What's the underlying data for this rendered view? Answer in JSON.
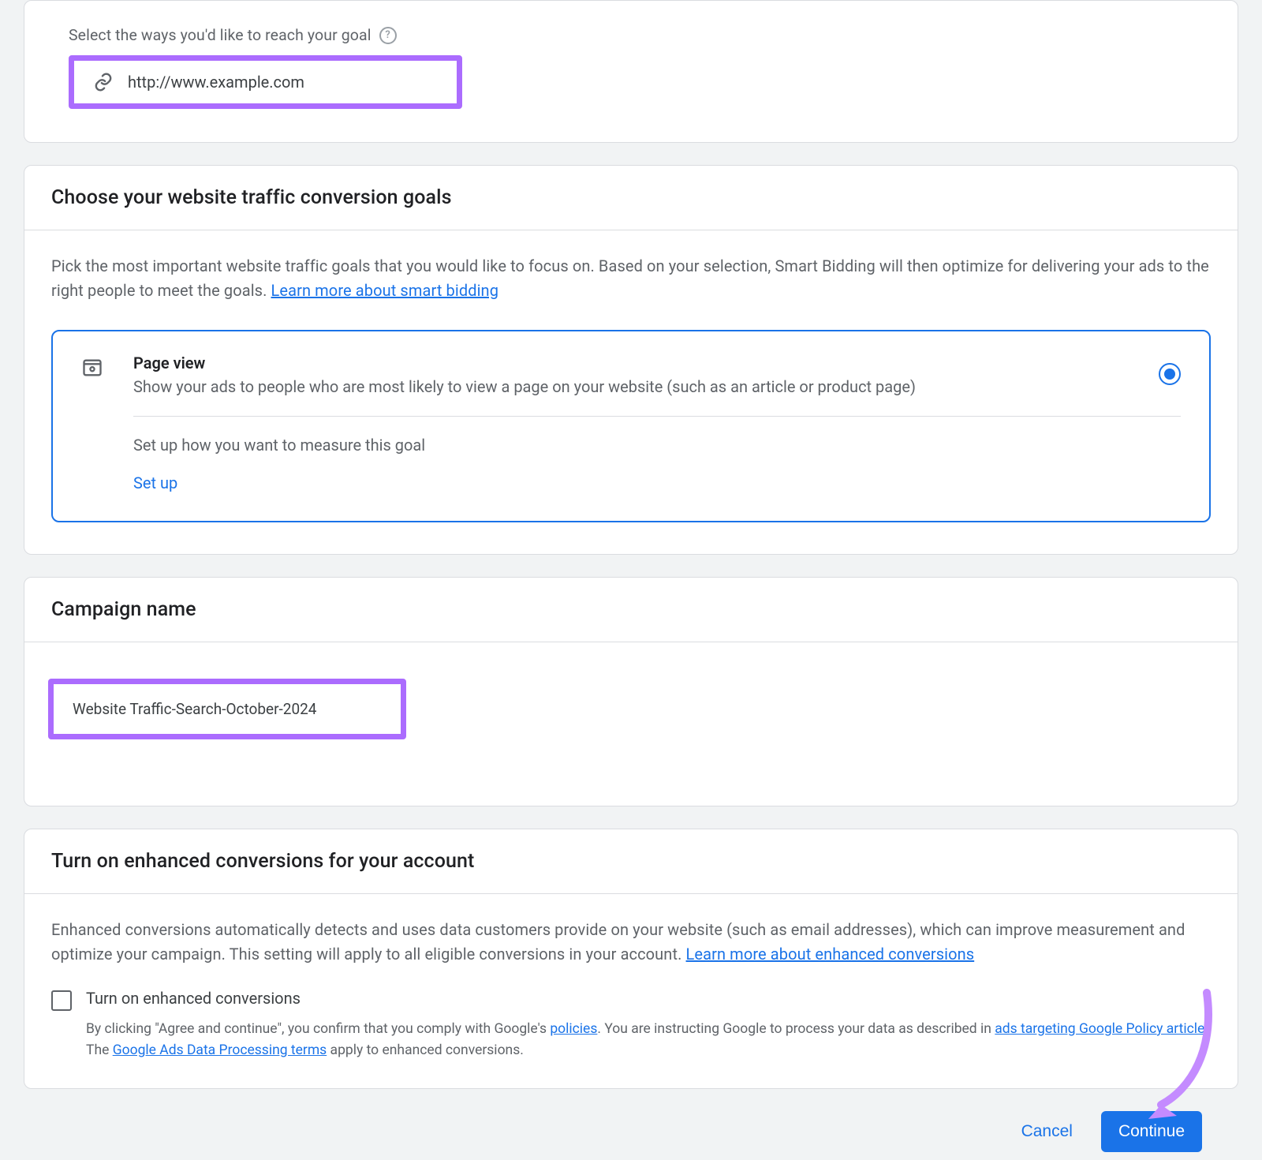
{
  "reach": {
    "label": "Select the ways you'd like to reach your goal",
    "url": "http://www.example.com"
  },
  "goals": {
    "title": "Choose your website traffic conversion goals",
    "intro": "Pick the most important website traffic goals that you would like to focus on. Based on your selection, Smart Bidding will then optimize for delivering your ads to the right people to meet the goals. ",
    "intro_link": "Learn more about smart bidding",
    "option": {
      "name": "Page view",
      "desc": "Show your ads to people who are most likely to view a page on your website (such as an article or product page)",
      "setup_hint": "Set up how you want to measure this goal",
      "setup_link": "Set up",
      "selected": true
    }
  },
  "campaign_name": {
    "title": "Campaign name",
    "value": "Website Traffic-Search-October-2024"
  },
  "enhanced": {
    "title": "Turn on enhanced conversions for your account",
    "intro": "Enhanced conversions automatically detects and uses data customers provide on your website (such as email addresses), which can improve measurement and optimize your campaign. This setting will apply to all eligible conversions in your account. ",
    "intro_link": "Learn more about enhanced conversions",
    "checkbox_label": "Turn on enhanced conversions",
    "legal_1": "By clicking \"Agree and continue\", you confirm that you comply with Google's ",
    "legal_link1": "policies",
    "legal_2": ". You are instructing Google to process your data as described in ",
    "legal_link2": "ads targeting Google Policy article",
    "legal_3": ". The ",
    "legal_link3": "Google Ads Data Processing terms",
    "legal_4": " apply to enhanced conversions."
  },
  "footer": {
    "cancel": "Cancel",
    "continue": "Continue"
  }
}
